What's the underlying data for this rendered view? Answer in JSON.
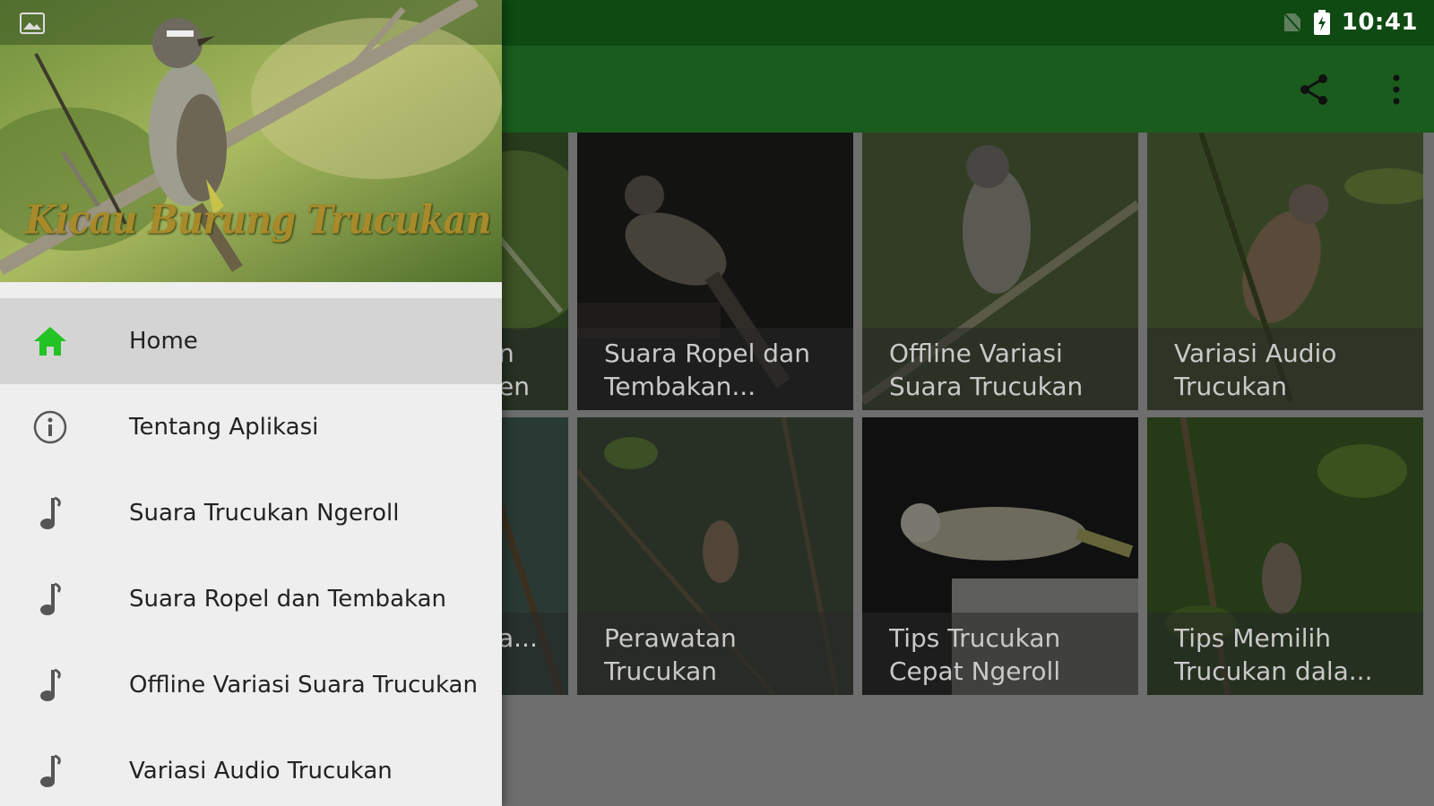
{
  "status_bar": {
    "time": "10:41",
    "icons": [
      "no-sim-icon",
      "battery-charging-icon"
    ]
  },
  "toolbar": {
    "actions": [
      {
        "name": "share-icon"
      },
      {
        "name": "overflow-menu-icon"
      }
    ],
    "color": "#1a5c1d"
  },
  "drawer": {
    "header_title": "Kicau Burung Trucukan Gacor",
    "items": [
      {
        "label": "Home",
        "icon": "home-icon",
        "active": true
      },
      {
        "label": "Tentang Aplikasi",
        "icon": "info-icon",
        "active": false
      },
      {
        "label": "Suara Trucukan Ngeroll",
        "icon": "music-note-icon",
        "active": false
      },
      {
        "label": "Suara Ropel dan Tembakan",
        "icon": "music-note-icon",
        "active": false
      },
      {
        "label": "Offline Variasi Suara Trucukan",
        "icon": "music-note-icon",
        "active": false
      },
      {
        "label": "Variasi Audio Trucukan",
        "icon": "music-note-icon",
        "active": false
      }
    ],
    "active_icon_color": "#22c322"
  },
  "grid": {
    "tiles": [
      {
        "line1": "n",
        "line2": "en"
      },
      {
        "line1": "Suara Ropel dan",
        "line2": "Tembakan..."
      },
      {
        "line1": "Offline Variasi",
        "line2": "Suara Trucukan"
      },
      {
        "line1": "Variasi Audio",
        "line2": "Trucukan"
      },
      {
        "line1": "",
        "line2": "a..."
      },
      {
        "line1": "Perawatan",
        "line2": "Trucukan"
      },
      {
        "line1": "Tips Trucukan",
        "line2": "Cepat Ngeroll"
      },
      {
        "line1": "Tips Memilih",
        "line2": "Trucukan dala..."
      }
    ]
  }
}
